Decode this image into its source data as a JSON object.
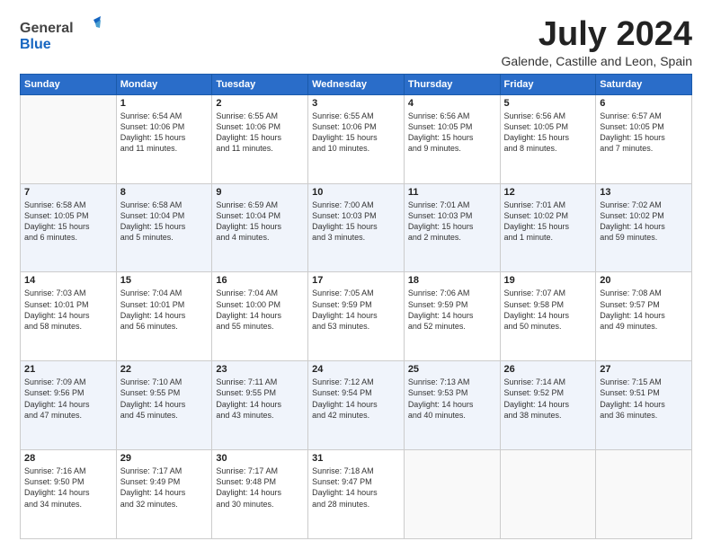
{
  "header": {
    "logo_general": "General",
    "logo_blue": "Blue",
    "month_title": "July 2024",
    "subtitle": "Galende, Castille and Leon, Spain"
  },
  "calendar": {
    "days_of_week": [
      "Sunday",
      "Monday",
      "Tuesday",
      "Wednesday",
      "Thursday",
      "Friday",
      "Saturday"
    ],
    "weeks": [
      [
        {
          "day": "",
          "info": ""
        },
        {
          "day": "1",
          "info": "Sunrise: 6:54 AM\nSunset: 10:06 PM\nDaylight: 15 hours\nand 11 minutes."
        },
        {
          "day": "2",
          "info": "Sunrise: 6:55 AM\nSunset: 10:06 PM\nDaylight: 15 hours\nand 11 minutes."
        },
        {
          "day": "3",
          "info": "Sunrise: 6:55 AM\nSunset: 10:06 PM\nDaylight: 15 hours\nand 10 minutes."
        },
        {
          "day": "4",
          "info": "Sunrise: 6:56 AM\nSunset: 10:05 PM\nDaylight: 15 hours\nand 9 minutes."
        },
        {
          "day": "5",
          "info": "Sunrise: 6:56 AM\nSunset: 10:05 PM\nDaylight: 15 hours\nand 8 minutes."
        },
        {
          "day": "6",
          "info": "Sunrise: 6:57 AM\nSunset: 10:05 PM\nDaylight: 15 hours\nand 7 minutes."
        }
      ],
      [
        {
          "day": "7",
          "info": "Sunrise: 6:58 AM\nSunset: 10:05 PM\nDaylight: 15 hours\nand 6 minutes."
        },
        {
          "day": "8",
          "info": "Sunrise: 6:58 AM\nSunset: 10:04 PM\nDaylight: 15 hours\nand 5 minutes."
        },
        {
          "day": "9",
          "info": "Sunrise: 6:59 AM\nSunset: 10:04 PM\nDaylight: 15 hours\nand 4 minutes."
        },
        {
          "day": "10",
          "info": "Sunrise: 7:00 AM\nSunset: 10:03 PM\nDaylight: 15 hours\nand 3 minutes."
        },
        {
          "day": "11",
          "info": "Sunrise: 7:01 AM\nSunset: 10:03 PM\nDaylight: 15 hours\nand 2 minutes."
        },
        {
          "day": "12",
          "info": "Sunrise: 7:01 AM\nSunset: 10:02 PM\nDaylight: 15 hours\nand 1 minute."
        },
        {
          "day": "13",
          "info": "Sunrise: 7:02 AM\nSunset: 10:02 PM\nDaylight: 14 hours\nand 59 minutes."
        }
      ],
      [
        {
          "day": "14",
          "info": "Sunrise: 7:03 AM\nSunset: 10:01 PM\nDaylight: 14 hours\nand 58 minutes."
        },
        {
          "day": "15",
          "info": "Sunrise: 7:04 AM\nSunset: 10:01 PM\nDaylight: 14 hours\nand 56 minutes."
        },
        {
          "day": "16",
          "info": "Sunrise: 7:04 AM\nSunset: 10:00 PM\nDaylight: 14 hours\nand 55 minutes."
        },
        {
          "day": "17",
          "info": "Sunrise: 7:05 AM\nSunset: 9:59 PM\nDaylight: 14 hours\nand 53 minutes."
        },
        {
          "day": "18",
          "info": "Sunrise: 7:06 AM\nSunset: 9:59 PM\nDaylight: 14 hours\nand 52 minutes."
        },
        {
          "day": "19",
          "info": "Sunrise: 7:07 AM\nSunset: 9:58 PM\nDaylight: 14 hours\nand 50 minutes."
        },
        {
          "day": "20",
          "info": "Sunrise: 7:08 AM\nSunset: 9:57 PM\nDaylight: 14 hours\nand 49 minutes."
        }
      ],
      [
        {
          "day": "21",
          "info": "Sunrise: 7:09 AM\nSunset: 9:56 PM\nDaylight: 14 hours\nand 47 minutes."
        },
        {
          "day": "22",
          "info": "Sunrise: 7:10 AM\nSunset: 9:55 PM\nDaylight: 14 hours\nand 45 minutes."
        },
        {
          "day": "23",
          "info": "Sunrise: 7:11 AM\nSunset: 9:55 PM\nDaylight: 14 hours\nand 43 minutes."
        },
        {
          "day": "24",
          "info": "Sunrise: 7:12 AM\nSunset: 9:54 PM\nDaylight: 14 hours\nand 42 minutes."
        },
        {
          "day": "25",
          "info": "Sunrise: 7:13 AM\nSunset: 9:53 PM\nDaylight: 14 hours\nand 40 minutes."
        },
        {
          "day": "26",
          "info": "Sunrise: 7:14 AM\nSunset: 9:52 PM\nDaylight: 14 hours\nand 38 minutes."
        },
        {
          "day": "27",
          "info": "Sunrise: 7:15 AM\nSunset: 9:51 PM\nDaylight: 14 hours\nand 36 minutes."
        }
      ],
      [
        {
          "day": "28",
          "info": "Sunrise: 7:16 AM\nSunset: 9:50 PM\nDaylight: 14 hours\nand 34 minutes."
        },
        {
          "day": "29",
          "info": "Sunrise: 7:17 AM\nSunset: 9:49 PM\nDaylight: 14 hours\nand 32 minutes."
        },
        {
          "day": "30",
          "info": "Sunrise: 7:17 AM\nSunset: 9:48 PM\nDaylight: 14 hours\nand 30 minutes."
        },
        {
          "day": "31",
          "info": "Sunrise: 7:18 AM\nSunset: 9:47 PM\nDaylight: 14 hours\nand 28 minutes."
        },
        {
          "day": "",
          "info": ""
        },
        {
          "day": "",
          "info": ""
        },
        {
          "day": "",
          "info": ""
        }
      ]
    ]
  }
}
